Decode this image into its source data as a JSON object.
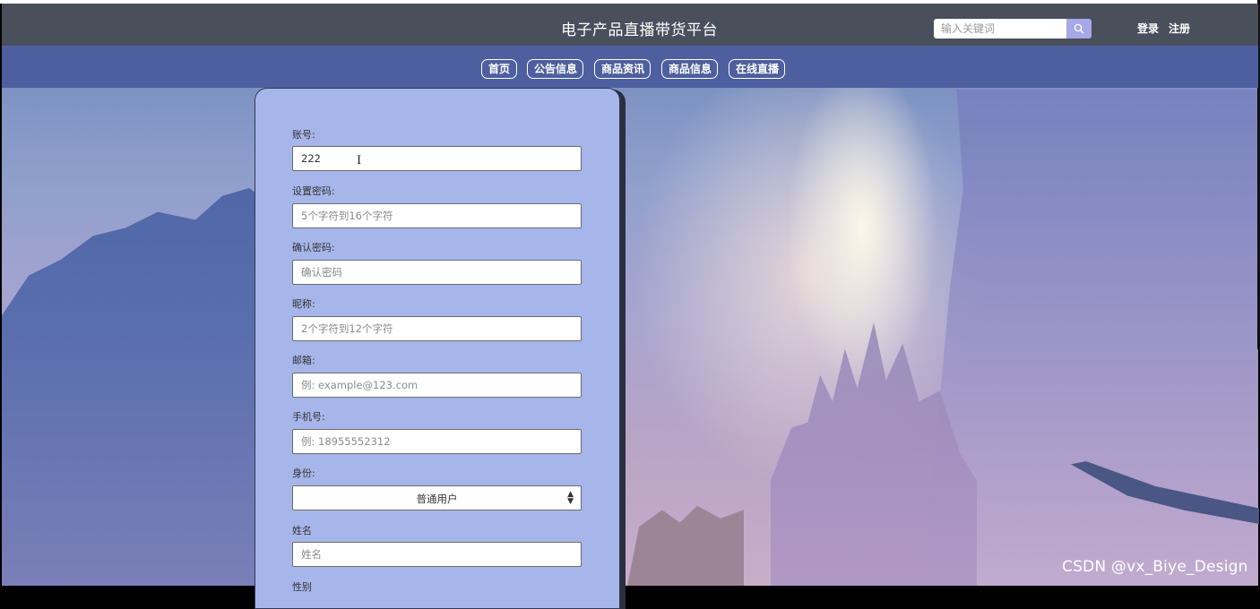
{
  "header": {
    "site_title": "电子产品直播带货平台",
    "search_placeholder": "输入关键词",
    "search_icon": "search-icon",
    "login_label": "登录",
    "register_label": "注册"
  },
  "nav": {
    "items": [
      {
        "label": "首页"
      },
      {
        "label": "公告信息"
      },
      {
        "label": "商品资讯"
      },
      {
        "label": "商品信息"
      },
      {
        "label": "在线直播"
      }
    ]
  },
  "form": {
    "account": {
      "label": "账号:",
      "value": "222",
      "placeholder": ""
    },
    "password": {
      "label": "设置密码:",
      "value": "",
      "placeholder": "5个字符到16个字符"
    },
    "confirm_password": {
      "label": "确认密码:",
      "value": "",
      "placeholder": "确认密码"
    },
    "nickname": {
      "label": "昵称:",
      "value": "",
      "placeholder": "2个字符到12个字符"
    },
    "email": {
      "label": "邮箱:",
      "value": "",
      "placeholder": "例: example@123.com"
    },
    "phone": {
      "label": "手机号:",
      "value": "",
      "placeholder": "例: 18955552312"
    },
    "role": {
      "label": "身份:",
      "selected": "普通用户",
      "arrow_icon": "select-arrows-icon"
    },
    "name": {
      "label": "姓名",
      "value": "",
      "placeholder": "姓名"
    },
    "gender": {
      "label": "性别"
    }
  },
  "watermark": "CSDN @vx_Biye_Design",
  "colors": {
    "topbar": "#4a4f5c",
    "navbar": "#4d5f9e",
    "panel": "#a7b6ea",
    "search_button": "#a7a8e6"
  }
}
